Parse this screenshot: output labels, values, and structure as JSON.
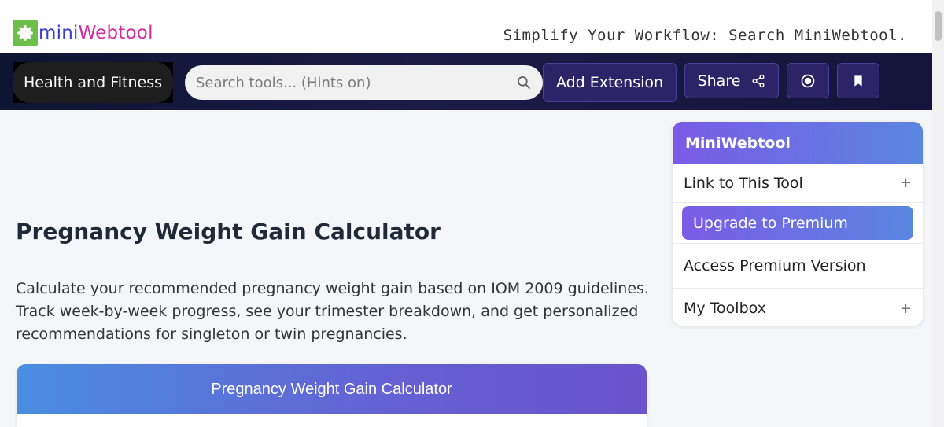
{
  "header": {
    "logo_mini": "mini",
    "logo_web": "Webtool",
    "tagline": "Simplify Your Workflow: Search MiniWebtool."
  },
  "nav": {
    "category": "Health and Fitness",
    "search_placeholder": "Search tools... (Hints on)",
    "add_extension": "Add Extension",
    "share": "Share"
  },
  "main": {
    "title": "Pregnancy Weight Gain Calculator",
    "description": "Calculate your recommended pregnancy weight gain based on IOM 2009 guidelines. Track week-by-week progress, see your trimester breakdown, and get personalized recommendations for singleton or twin pregnancies.",
    "card_title": "Pregnancy Weight Gain Calculator"
  },
  "sidebar": {
    "title": "MiniWebtool",
    "link_tool": "Link to This Tool",
    "upgrade": "Upgrade to Premium",
    "access_premium": "Access Premium Version",
    "toolbox": "My Toolbox",
    "plus": "+"
  },
  "colors": {
    "accent_purple": "#7a5be6",
    "accent_blue": "#5b86e0",
    "nav_bg": "#14143c",
    "logo_green": "#6cc04a"
  }
}
